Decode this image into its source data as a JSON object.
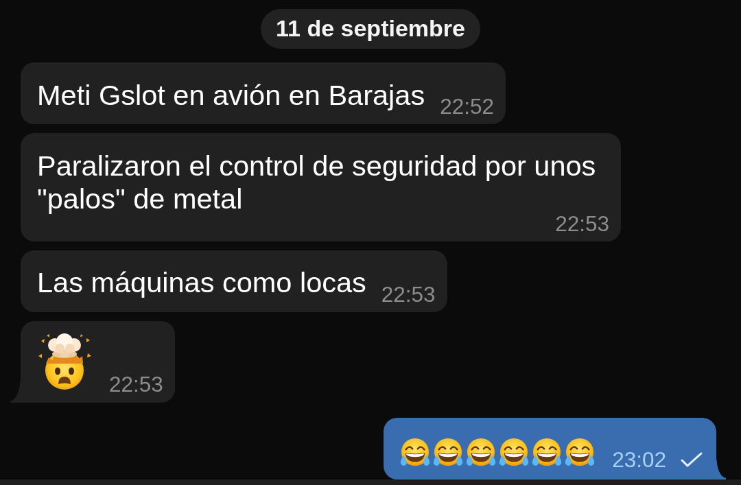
{
  "date_separator": {
    "label": "11 de septiembre"
  },
  "messages": [
    {
      "kind": "text",
      "outgoing": false,
      "text": "Meti Gslot en avión en Barajas",
      "time": "22:52",
      "tail": false
    },
    {
      "kind": "text",
      "outgoing": false,
      "text": "Paralizaron el control de seguridad por unos \"palos\" de metal",
      "time": "22:53",
      "tail": false
    },
    {
      "kind": "text",
      "outgoing": false,
      "text": "Las máquinas como locas",
      "time": "22:53",
      "tail": false
    },
    {
      "kind": "emoji",
      "outgoing": false,
      "emojis": [
        {
          "kind": "exploding"
        }
      ],
      "time": "22:53",
      "tail": true
    },
    {
      "kind": "emoji",
      "outgoing": true,
      "emojis": [
        {
          "kind": "laughing"
        },
        {
          "kind": "laughing"
        },
        {
          "kind": "laughing"
        },
        {
          "kind": "laughing"
        },
        {
          "kind": "laughing"
        },
        {
          "kind": "laughing"
        }
      ],
      "time": "23:02",
      "tail": true,
      "read": false
    }
  ]
}
